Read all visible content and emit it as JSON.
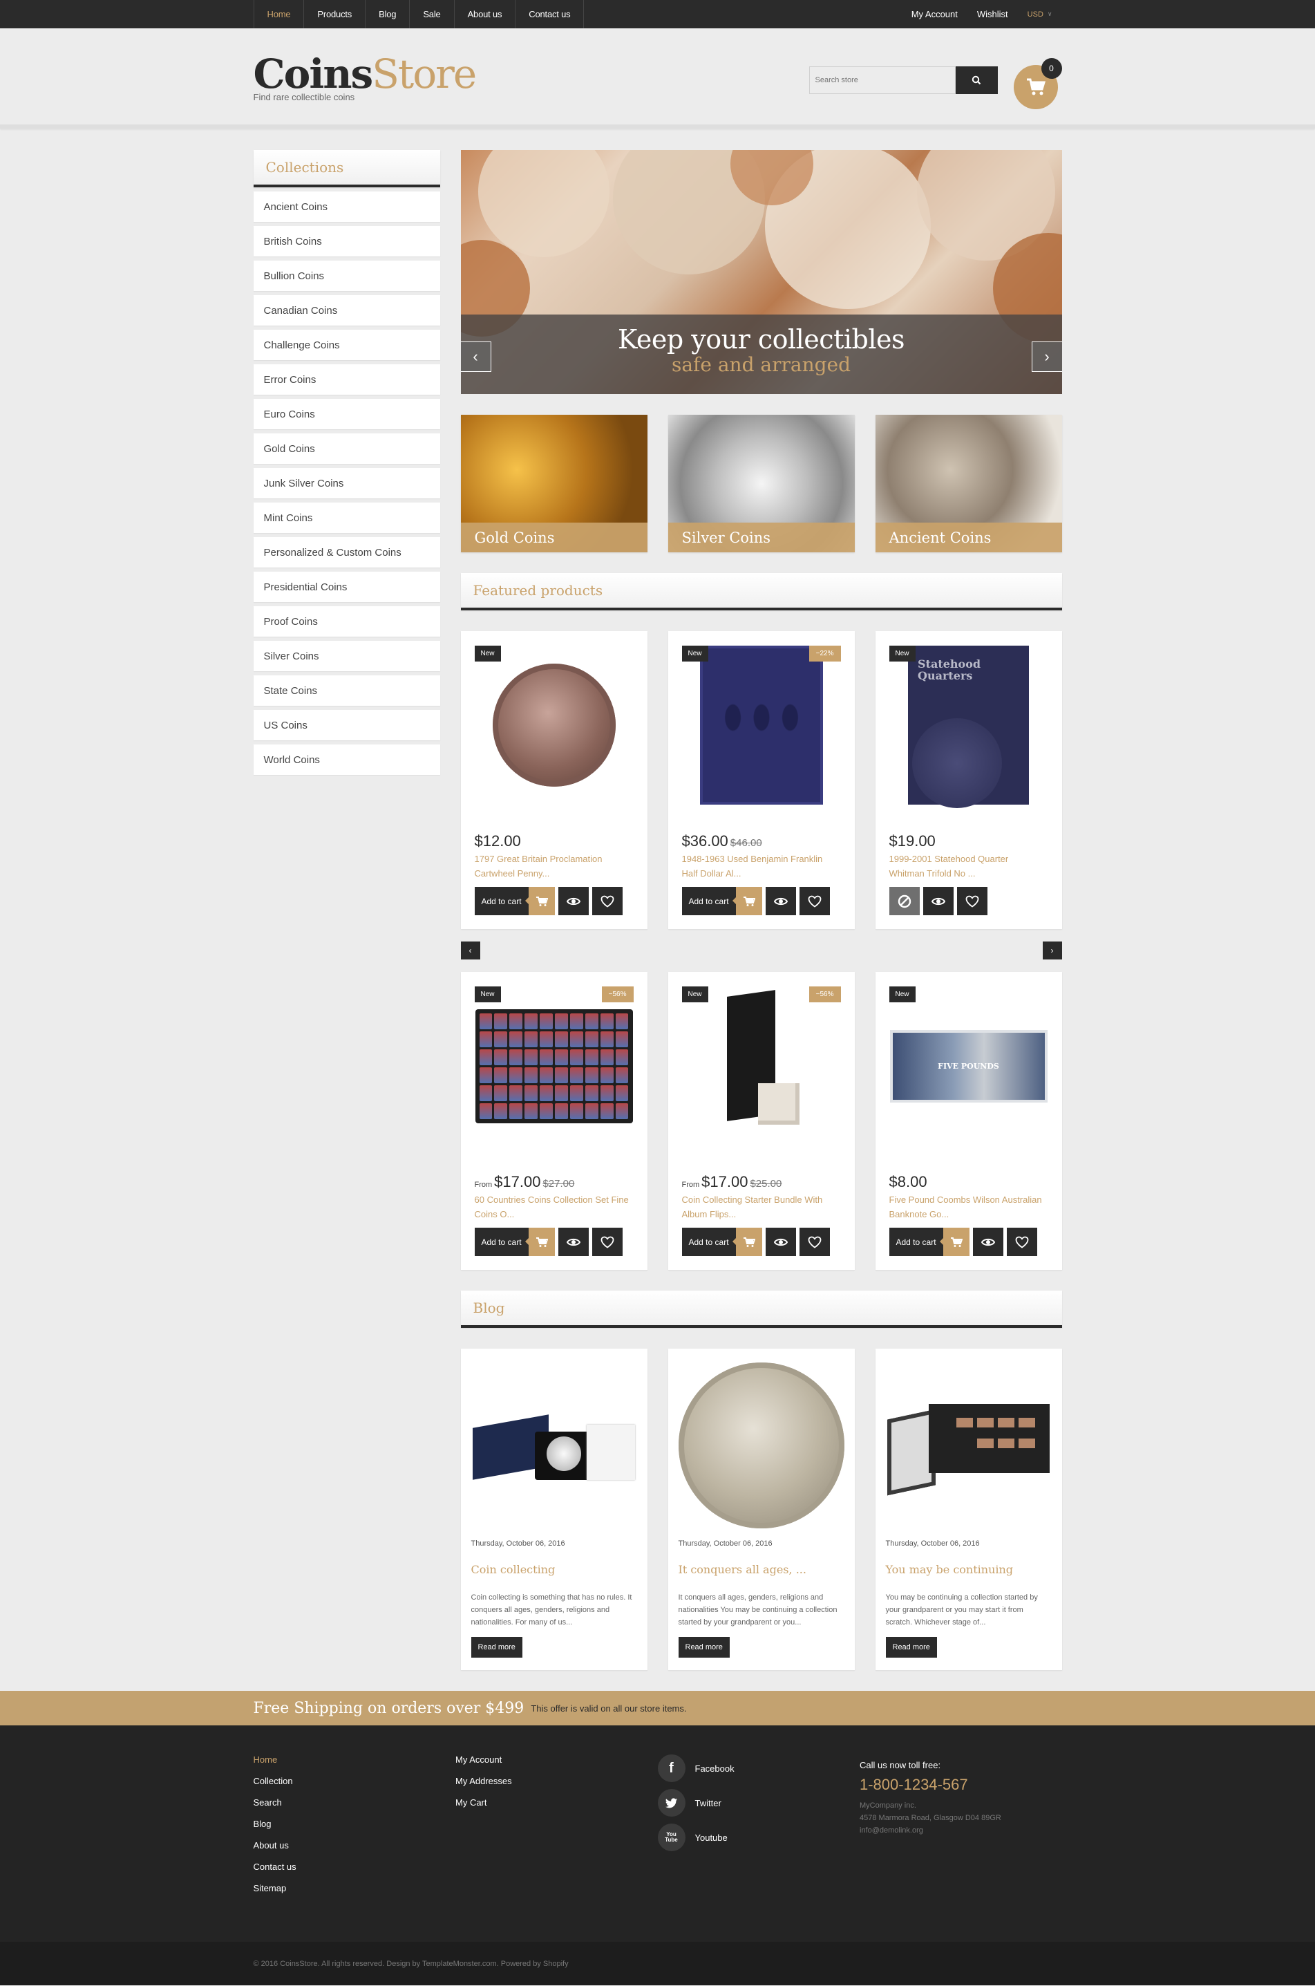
{
  "topnav": {
    "items": [
      {
        "label": "Home",
        "active": true
      },
      {
        "label": "Products"
      },
      {
        "label": "Blog"
      },
      {
        "label": "Sale"
      },
      {
        "label": "About us"
      },
      {
        "label": "Contact us"
      }
    ],
    "account": "My Account",
    "wishlist": "Wishlist",
    "currency": "USD"
  },
  "header": {
    "logo_bold": "Coins",
    "logo_light": "Store",
    "tagline": "Find rare collectible coins",
    "search_placeholder": "Search store",
    "cart_count": "0"
  },
  "sidebar": {
    "title": "Collections",
    "items": [
      "Ancient Coins",
      "British Coins",
      "Bullion Coins",
      "Canadian Coins",
      "Challenge Coins",
      "Error Coins",
      "Euro Coins",
      "Gold Coins",
      "Junk Silver Coins",
      "Mint Coins",
      "Personalized & Custom Coins",
      "Presidential Coins",
      "Proof Coins",
      "Silver Coins",
      "State Coins",
      "US Coins",
      "World Coins"
    ]
  },
  "slider": {
    "line1": "Keep your collectibles",
    "line2": "safe and arranged",
    "prev": "‹",
    "next": "›"
  },
  "categories": [
    "Gold Coins",
    "Silver Coins",
    "Ancient Coins"
  ],
  "featured": {
    "title": "Featured products",
    "add_to_cart": "Add to cart",
    "new_label": "New",
    "from_label": "From",
    "prev": "‹",
    "next": "›",
    "products": [
      {
        "price": "$12.00",
        "old": "",
        "from": false,
        "name1": "1797 Great Britain Proclamation",
        "name2": "Cartwheel Penny...",
        "sale": "",
        "sold_out": false
      },
      {
        "price": "$36.00",
        "old": "$46.00",
        "from": false,
        "name1": "1948-1963 Used Benjamin Franklin",
        "name2": "Half Dollar Al...",
        "sale": "−22%",
        "sold_out": false
      },
      {
        "price": "$19.00",
        "old": "",
        "from": false,
        "name1": "1999-2001 Statehood Quarter",
        "name2": "Whitman Trifold No ...",
        "sale": "",
        "sold_out": true
      },
      {
        "price": "$17.00",
        "old": "$27.00",
        "from": true,
        "name1": "60 Countries Coins Collection Set Fine",
        "name2": "Coins O...",
        "sale": "−56%",
        "sold_out": false
      },
      {
        "price": "$17.00",
        "old": "$25.00",
        "from": true,
        "name1": "Coin Collecting Starter Bundle With",
        "name2": "Album Flips...",
        "sale": "−56%",
        "sold_out": false
      },
      {
        "price": "$8.00",
        "old": "",
        "from": false,
        "name1": "Five Pound Coombs Wilson Australian",
        "name2": "Banknote Go...",
        "sale": "",
        "sold_out": false
      }
    ],
    "folder_title": "Statehood Quarters",
    "note_text": "FIVE POUNDS"
  },
  "blog": {
    "title": "Blog",
    "read_more": "Read more",
    "posts": [
      {
        "date": "Thursday, October 06, 2016",
        "title": "Coin collecting",
        "excerpt": "Coin collecting is something that has no rules. It conquers all ages, genders, religions and nationalities. For many of us..."
      },
      {
        "date": "Thursday, October 06, 2016",
        "title": "It conquers all ages, ...",
        "excerpt": "It conquers all ages, genders, religions and nationalities You may be continuing a collection started by your grandparent or you..."
      },
      {
        "date": "Thursday, October 06, 2016",
        "title": "You may be continuing",
        "excerpt": "You may be continuing a collection started by your grandparent or you may start it from scratch. Whichever stage of..."
      }
    ]
  },
  "shipping": {
    "headline": "Free Shipping on orders over $499",
    "note": "This offer is valid on all our store items."
  },
  "footer": {
    "col1": [
      "Home",
      "Collection",
      "Search",
      "Blog",
      "About us",
      "Contact us",
      "Sitemap"
    ],
    "col2": [
      "My Account",
      "My Addresses",
      "My Cart"
    ],
    "social": [
      "Facebook",
      "Twitter",
      "Youtube"
    ],
    "call_label": "Call us now toll free:",
    "phone": "1-800-1234-567",
    "company": "MyCompany inc.",
    "address": "4578 Marmora Road, Glasgow D04 89GR",
    "email": "info@demolink.org",
    "copyright": "© 2016 CoinsStore. All rights reserved. Design by TemplateMonster.com. Powered by Shopify"
  },
  "colors": {
    "accent": "#c9a26b",
    "dark": "#2b2b2b",
    "background": "#ececec"
  }
}
